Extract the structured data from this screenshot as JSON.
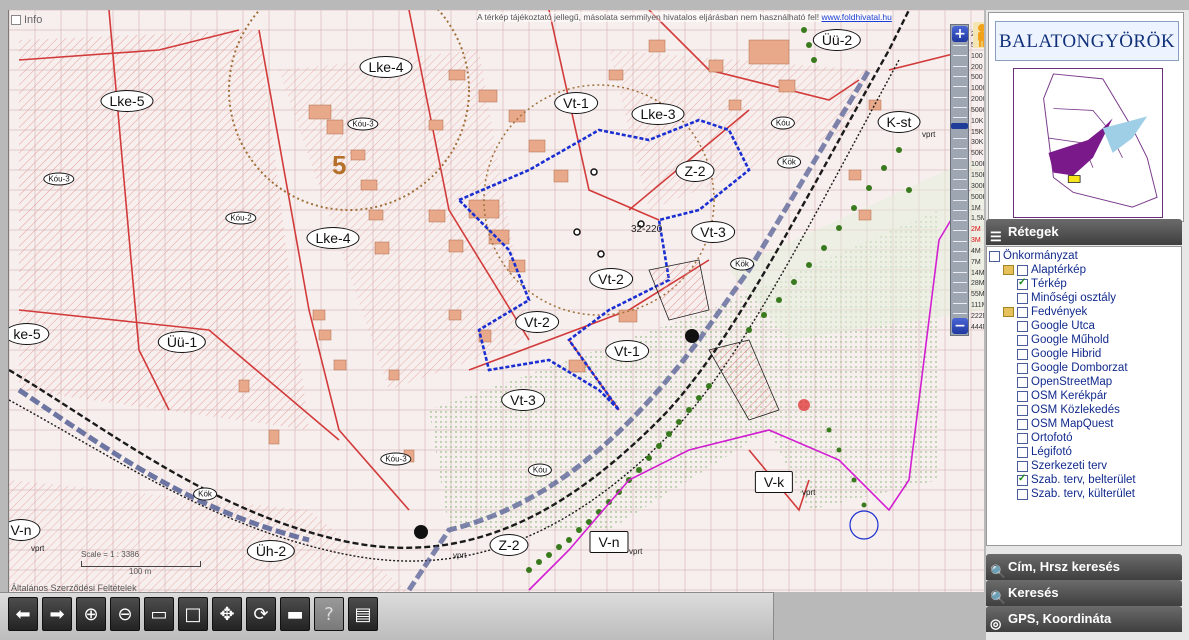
{
  "map": {
    "info_label": "Info",
    "disclaimer_text": "A térkép tájékoztató jellegű, másolata semmilyen hivatalos eljárásban nem használható fel!",
    "disclaimer_link": "www.foldhivatal.hu",
    "big_number": "5",
    "scale_text": "Scale = 1 : 3386",
    "scale_bar_label": "100 m",
    "footer_link": "Általános Szerződési Feltételek",
    "parcel_label": "32-220",
    "zones": [
      {
        "label": "Lke-5"
      },
      {
        "label": "Lke-4"
      },
      {
        "label": "Lke-4"
      },
      {
        "label": "Kóu-3"
      },
      {
        "label": "Kóu-3"
      },
      {
        "label": "Kóu-2"
      },
      {
        "label": "ke-5"
      },
      {
        "label": "Üü-1"
      },
      {
        "label": "Vt-1"
      },
      {
        "label": "Lke-3"
      },
      {
        "label": "Z-2"
      },
      {
        "label": "Vt-3"
      },
      {
        "label": "Vt-2"
      },
      {
        "label": "Vt-2"
      },
      {
        "label": "Vt-1"
      },
      {
        "label": "Vt-3"
      },
      {
        "label": "Üü-2"
      },
      {
        "label": "K-st"
      },
      {
        "label": "Kóu"
      },
      {
        "label": "Kök"
      },
      {
        "label": "Kök"
      },
      {
        "label": "Kök"
      },
      {
        "label": "Kóu-3"
      },
      {
        "label": "Kóu"
      },
      {
        "label": "V-k"
      },
      {
        "label": "V-n"
      },
      {
        "label": "Z-2"
      },
      {
        "label": "V-n"
      },
      {
        "label": "Üh-2"
      }
    ],
    "vprt_labels": [
      "vprt",
      "vprt",
      "vprt",
      "vprt",
      "vprt"
    ]
  },
  "zoom": {
    "plus_label": "+",
    "minus_label": "−",
    "scales": [
      "25",
      "50",
      "100",
      "200",
      "500",
      "1000",
      "2000",
      "5000",
      "10K",
      "15K",
      "30K",
      "50K",
      "100K",
      "150K",
      "300K",
      "500K",
      "1M",
      "1,5M",
      "2M",
      "3M",
      "4M",
      "7M",
      "14M",
      "28M",
      "55M",
      "111M",
      "222M",
      "444M"
    ]
  },
  "panel": {
    "logo_text": "BALATONGYÖRÖK",
    "layers_title": "Rétegek",
    "layers": [
      {
        "label": "Önkormányzat",
        "checked": false,
        "folder": false,
        "indent": 0
      },
      {
        "label": "Alaptérkép",
        "checked": false,
        "folder": true,
        "indent": 1
      },
      {
        "label": "Térkép",
        "checked": true,
        "folder": false,
        "indent": 2
      },
      {
        "label": "Minőségi osztály",
        "checked": false,
        "folder": false,
        "indent": 2
      },
      {
        "label": "Fedvények",
        "checked": false,
        "folder": true,
        "indent": 1
      },
      {
        "label": "Google Utca",
        "checked": false,
        "folder": false,
        "indent": 2
      },
      {
        "label": "Google Műhold",
        "checked": false,
        "folder": false,
        "indent": 2
      },
      {
        "label": "Google Hibrid",
        "checked": false,
        "folder": false,
        "indent": 2
      },
      {
        "label": "Google Domborzat",
        "checked": false,
        "folder": false,
        "indent": 2
      },
      {
        "label": "OpenStreetMap",
        "checked": false,
        "folder": false,
        "indent": 2
      },
      {
        "label": "OSM Kerékpár",
        "checked": false,
        "folder": false,
        "indent": 2
      },
      {
        "label": "OSM Közlekedés",
        "checked": false,
        "folder": false,
        "indent": 2
      },
      {
        "label": "OSM MapQuest",
        "checked": false,
        "folder": false,
        "indent": 2
      },
      {
        "label": "Ortofotó",
        "checked": false,
        "folder": false,
        "indent": 2
      },
      {
        "label": "Légifotó",
        "checked": false,
        "folder": false,
        "indent": 2
      },
      {
        "label": "Szerkezeti terv",
        "checked": false,
        "folder": false,
        "indent": 2
      },
      {
        "label": "Szab. terv, belterület",
        "checked": true,
        "folder": false,
        "indent": 2
      },
      {
        "label": "Szab. terv, külterület",
        "checked": false,
        "folder": false,
        "indent": 2
      }
    ],
    "search_address": "Cím, Hrsz keresés",
    "search": "Keresés",
    "gps": "GPS, Koordináta"
  },
  "toolbar": {
    "buttons": [
      {
        "name": "back-button",
        "icon": "arrow-left-icon",
        "glyph": "⬅"
      },
      {
        "name": "forward-button",
        "icon": "arrow-right-icon",
        "glyph": "➡"
      },
      {
        "name": "zoom-in-button",
        "icon": "zoom-in-icon",
        "glyph": "⊕"
      },
      {
        "name": "zoom-out-button",
        "icon": "zoom-out-icon",
        "glyph": "⊖"
      },
      {
        "name": "zoom-box-button",
        "icon": "zoom-box-icon",
        "glyph": "▭"
      },
      {
        "name": "full-extent-button",
        "icon": "full-extent-icon",
        "glyph": "□"
      },
      {
        "name": "pan-button",
        "icon": "pan-icon",
        "glyph": "✥"
      },
      {
        "name": "refresh-button",
        "icon": "refresh-icon",
        "glyph": "⟳"
      },
      {
        "name": "measure-button",
        "icon": "ruler-icon",
        "glyph": "▬"
      },
      {
        "name": "help-button",
        "icon": "help-icon",
        "glyph": "?"
      },
      {
        "name": "print-button",
        "icon": "document-icon",
        "glyph": "▤"
      }
    ]
  },
  "colors": {
    "zone_red": "#d23b3b",
    "building": "#e7a98a",
    "blue_boundary": "#1b2fd1",
    "tree_green": "#3a7a1f",
    "road_dark": "#1a1a1a",
    "magenta": "#d21fd2"
  }
}
